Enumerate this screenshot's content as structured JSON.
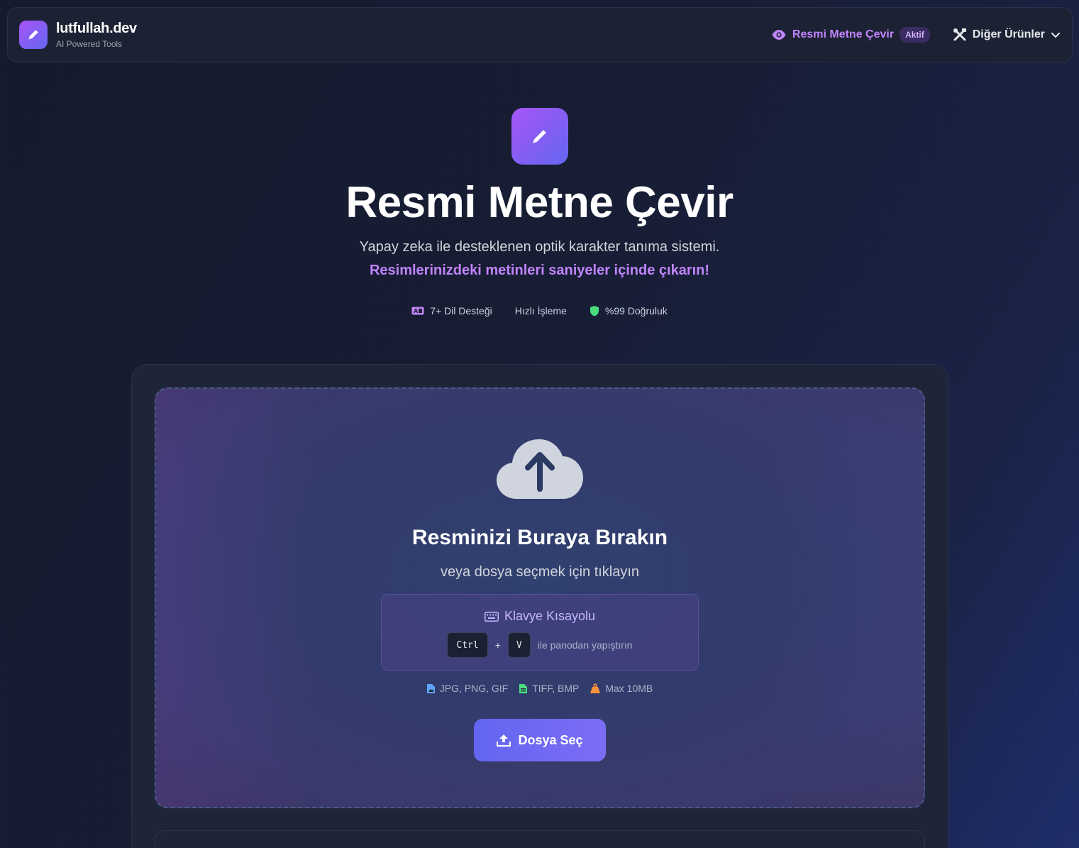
{
  "header": {
    "brand_name": "lutfullah.dev",
    "brand_subtitle": "AI Powered Tools",
    "nav_active_label": "Resmi Metne Çevir",
    "nav_active_badge": "Aktif",
    "nav_other_label": "Diğer Ürünler"
  },
  "hero": {
    "title": "Resmi Metne Çevir",
    "description": "Yapay zeka ile desteklenen optik karakter tanıma sistemi.",
    "accent": "Resimlerinizdeki metinleri saniyeler içinde çıkarın!",
    "features": [
      {
        "label": "7+ Dil Desteği",
        "icon": "language-icon"
      },
      {
        "label": "Hızlı İşleme",
        "icon": ""
      },
      {
        "label": "%99 Doğruluk",
        "icon": "shield-icon"
      }
    ]
  },
  "dropzone": {
    "title": "Resminizi Buraya Bırakın",
    "subtitle": "veya dosya seçmek için tıklayın",
    "shortcut": {
      "title": "Klavye Kısayolu",
      "key1": "Ctrl",
      "plus": "+",
      "key2": "V",
      "text": "ile panodan yapıştırın"
    },
    "formats": [
      {
        "label": "JPG, PNG, GIF",
        "icon": "image-file-icon",
        "color": "#60a5fa"
      },
      {
        "label": "TIFF, BMP",
        "icon": "document-file-icon",
        "color": "#4ade80"
      },
      {
        "label": "Max 10MB",
        "icon": "weight-icon",
        "color": "#fb923c"
      }
    ],
    "button_label": "Dosya Seç"
  },
  "colors": {
    "accent": "#a855f7",
    "accent_secondary": "#6366f1",
    "background": "#151a2e",
    "card": "#1e2538"
  }
}
